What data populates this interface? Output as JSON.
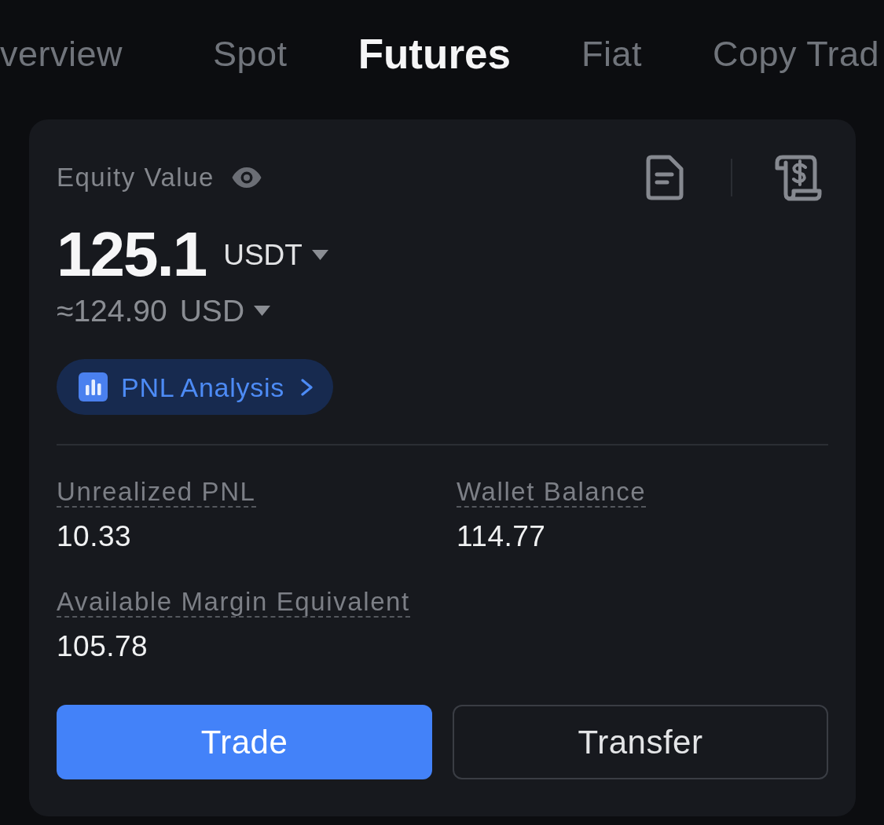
{
  "tabs": [
    {
      "label": "verview",
      "selected": false
    },
    {
      "label": "Spot",
      "selected": false
    },
    {
      "label": "Futures",
      "selected": true
    },
    {
      "label": "Fiat",
      "selected": false
    },
    {
      "label": "Copy Trad",
      "selected": false
    }
  ],
  "equity": {
    "label": "Equity Value",
    "amount": "125.1",
    "currency": "USDT",
    "approx_amount": "≈124.90",
    "approx_currency": "USD"
  },
  "pnl_analysis": {
    "label": "PNL Analysis"
  },
  "stats": [
    {
      "label": "Unrealized PNL",
      "value": "10.33"
    },
    {
      "label": "Wallet Balance",
      "value": "114.77"
    },
    {
      "label": "Available Margin Equivalent",
      "value": "105.78"
    }
  ],
  "actions": [
    {
      "label": "Trade",
      "kind": "primary"
    },
    {
      "label": "Transfer",
      "kind": "outline"
    }
  ]
}
